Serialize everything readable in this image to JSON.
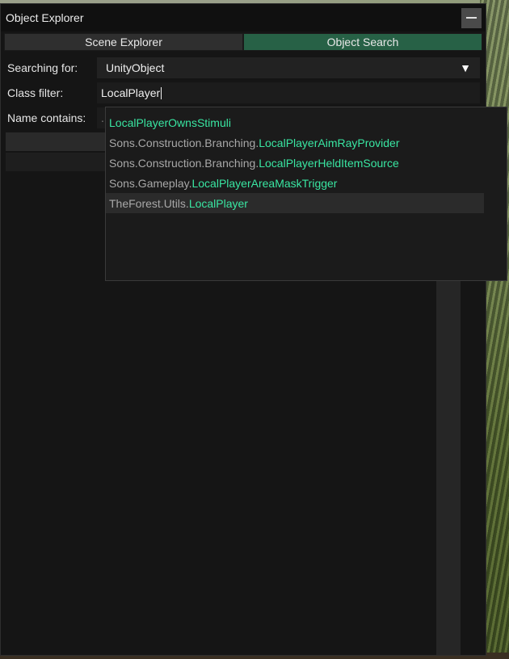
{
  "window": {
    "title": "Object Explorer",
    "minimize_icon": "minus-icon"
  },
  "tabs": [
    {
      "label": "Scene Explorer",
      "active": false
    },
    {
      "label": "Object Search",
      "active": true
    }
  ],
  "form": {
    "searching_for_label": "Searching for:",
    "searching_for_value": "UnityObject",
    "dropdown_icon": "triangle-down-icon",
    "class_filter_label": "Class filter:",
    "class_filter_value": "LocalPlayer",
    "name_contains_label": "Name contains:",
    "name_contains_placeholder": "..."
  },
  "suggestions": [
    {
      "namespace": "",
      "class": "LocalPlayerOwnsStimuli",
      "highlighted": false
    },
    {
      "namespace": "Sons.Construction.Branching.",
      "class": "LocalPlayerAimRayProvider",
      "highlighted": false
    },
    {
      "namespace": "Sons.Construction.Branching.",
      "class": "LocalPlayerHeldItemSource",
      "highlighted": false
    },
    {
      "namespace": "Sons.Gameplay.",
      "class": "LocalPlayerAreaMaskTrigger",
      "highlighted": false
    },
    {
      "namespace": "TheForest.Utils.",
      "class": "LocalPlayer",
      "highlighted": true
    }
  ],
  "colors": {
    "active_tab": "#276146",
    "class_highlight": "#39e6a2",
    "namespace_text": "#a8a8a8",
    "panel_bg": "#151515"
  }
}
